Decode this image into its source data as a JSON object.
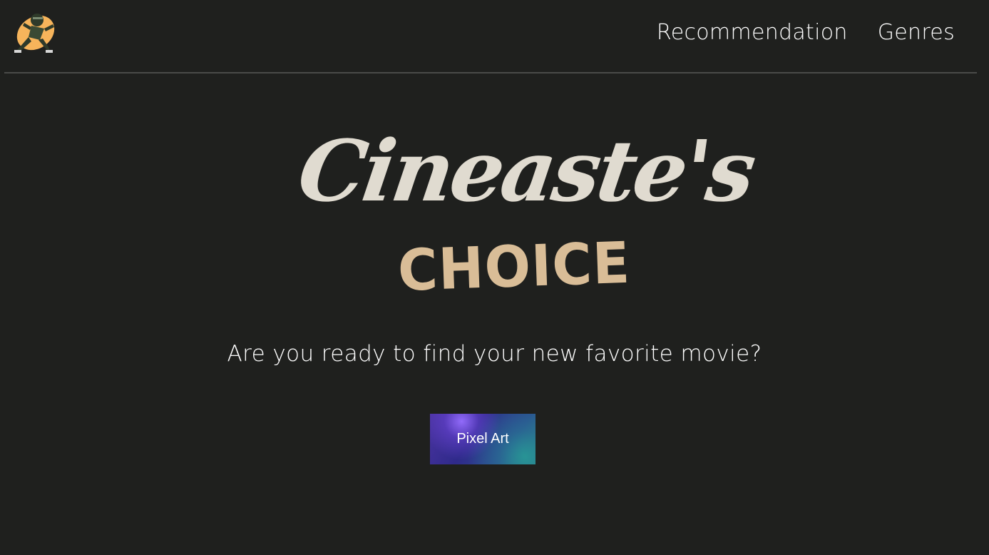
{
  "header": {
    "nav": [
      {
        "label": "Recommendation"
      },
      {
        "label": "Genres"
      }
    ]
  },
  "brand": {
    "line1": "Cineaste's",
    "line2": "CHOICE",
    "line1_color": "#e0dbd0",
    "line2_color": "#d9bd97"
  },
  "hero": {
    "tagline": "Are you ready to find your new favorite movie?",
    "button_label": "Pixel Art"
  },
  "colors": {
    "background": "#1f201e",
    "divider": "#4a4b49",
    "logo_orange": "#f6b45b"
  },
  "icons": {
    "logo": "ninja-character-logo-icon"
  }
}
